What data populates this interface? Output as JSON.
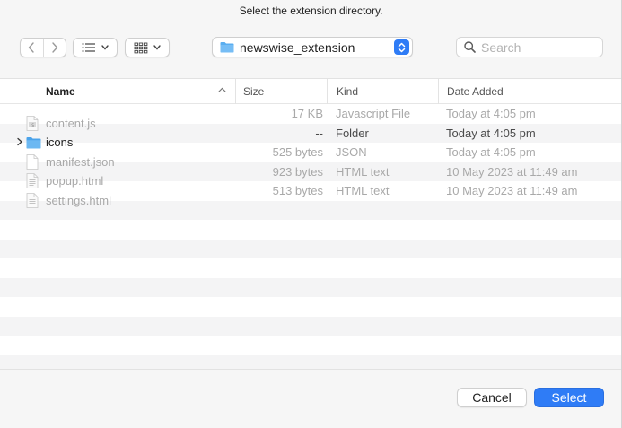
{
  "dialog": {
    "title": "Select the extension directory."
  },
  "toolbar": {
    "back_icon": "chevron-left-icon",
    "forward_icon": "chevron-right-icon",
    "view_mode_icon": "list-view-icon",
    "grid_icon": "icon-grid-icon",
    "location": "newswise_extension",
    "search_placeholder": "Search",
    "search_value": ""
  },
  "columns": {
    "name": "Name",
    "size": "Size",
    "kind": "Kind",
    "date_added": "Date Added",
    "sort_column": "Name",
    "sort_direction": "ascending"
  },
  "files": [
    {
      "name": "content.js",
      "size": "17 KB",
      "kind": "Javascript File",
      "date_added": "Today at 4:05 pm",
      "icon": "js-file-icon",
      "enabled": false,
      "is_folder": false
    },
    {
      "name": "icons",
      "size": "--",
      "kind": "Folder",
      "date_added": "Today at 4:05 pm",
      "icon": "folder-icon",
      "enabled": true,
      "is_folder": true
    },
    {
      "name": "manifest.json",
      "size": "525 bytes",
      "kind": "JSON",
      "date_added": "Today at 4:05 pm",
      "icon": "document-icon",
      "enabled": false,
      "is_folder": false
    },
    {
      "name": "popup.html",
      "size": "923 bytes",
      "kind": "HTML text",
      "date_added": "10 May 2023 at 11:49 am",
      "icon": "html-file-icon",
      "enabled": false,
      "is_folder": false
    },
    {
      "name": "settings.html",
      "size": "513 bytes",
      "kind": "HTML text",
      "date_added": "10 May 2023 at 11:49 am",
      "icon": "html-file-icon",
      "enabled": false,
      "is_folder": false
    }
  ],
  "buttons": {
    "cancel": "Cancel",
    "select": "Select"
  },
  "colors": {
    "accent": "#2f7cf6",
    "folder": "#5aaef0",
    "row_alt": "#f4f4f5",
    "disabled_text": "#a9a9a9"
  }
}
